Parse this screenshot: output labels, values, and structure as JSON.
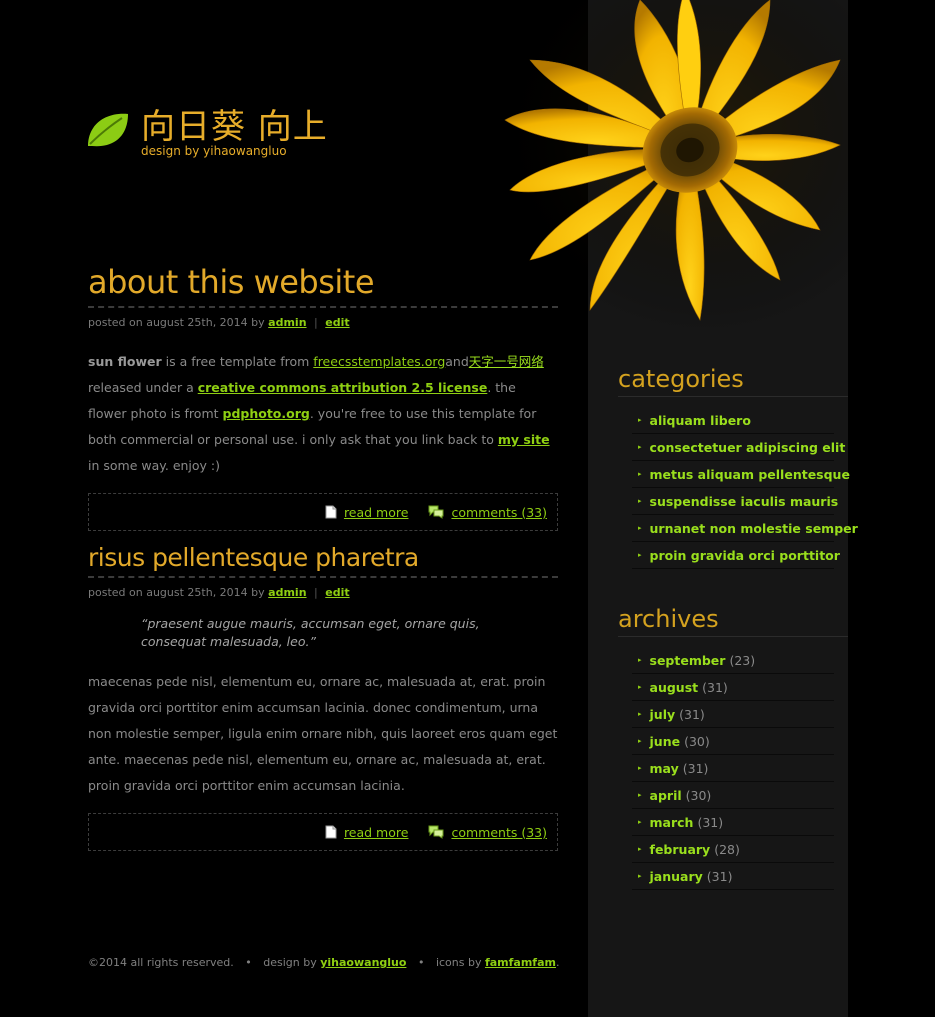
{
  "header": {
    "title": "向日葵 向上",
    "subtitle": "design by yihaowangluo"
  },
  "posts": [
    {
      "title": "about this website",
      "meta_prefix": "posted on august 25th, 2014 by",
      "author": "admin",
      "edit": "edit",
      "body": {
        "lead_bold": "sun flower",
        "t1": " is a free template from ",
        "link1": "freecsstemplates.org",
        "t2": "and",
        "link2": "天字一号网络",
        "t3": "released under a ",
        "link3": "creative commons attribution 2.5 license",
        "t4": ". the flower photo is fromt ",
        "link4": "pdphoto.org",
        "t5": ". you're free to use this template for both commercial or personal use. i only ask that you link back to ",
        "link5": "my site",
        "t6": " in some way. enjoy :)"
      },
      "read_more": "read more",
      "comments": "comments (33)"
    },
    {
      "title": "risus pellentesque pharetra",
      "meta_prefix": "posted on august 25th, 2014 by",
      "author": "admin",
      "edit": "edit",
      "quote": "“praesent augue mauris, accumsan eget, ornare quis, consequat malesuada, leo.”",
      "body_text": "maecenas pede nisl, elementum eu, ornare ac, malesuada at, erat. proin gravida orci porttitor enim accumsan lacinia. donec condimentum, urna non molestie semper, ligula enim ornare nibh, quis laoreet eros quam eget ante. maecenas pede nisl, elementum eu, ornare ac, malesuada at, erat. proin gravida orci porttitor enim accumsan lacinia.",
      "read_more": "read more",
      "comments": "comments (33)"
    }
  ],
  "sidebar": {
    "categories_title": "categories",
    "categories": [
      "aliquam libero",
      "consectetuer adipiscing elit",
      "metus aliquam pellentesque",
      "suspendisse iaculis mauris",
      "urnanet non molestie semper",
      "proin gravida orci porttitor"
    ],
    "archives_title": "archives",
    "archives": [
      {
        "month": "september",
        "count": "(23)"
      },
      {
        "month": "august",
        "count": "(31)"
      },
      {
        "month": "july",
        "count": "(31)"
      },
      {
        "month": "june",
        "count": "(30)"
      },
      {
        "month": "may",
        "count": "(31)"
      },
      {
        "month": "april",
        "count": "(30)"
      },
      {
        "month": "march",
        "count": "(31)"
      },
      {
        "month": "february",
        "count": "(28)"
      },
      {
        "month": "january",
        "count": "(31)"
      }
    ]
  },
  "footer": {
    "copyright": "©2014 all rights reserved.",
    "dot": "•",
    "design_by": "design by",
    "design_link": "yihaowangluo",
    "icons_by": "icons by",
    "icons_link": "famfamfam",
    "period": "."
  },
  "colors": {
    "background": "#000000",
    "sidebar": "#161616",
    "accent_gold": "#e2a92a",
    "link_green": "#8fcf12"
  }
}
